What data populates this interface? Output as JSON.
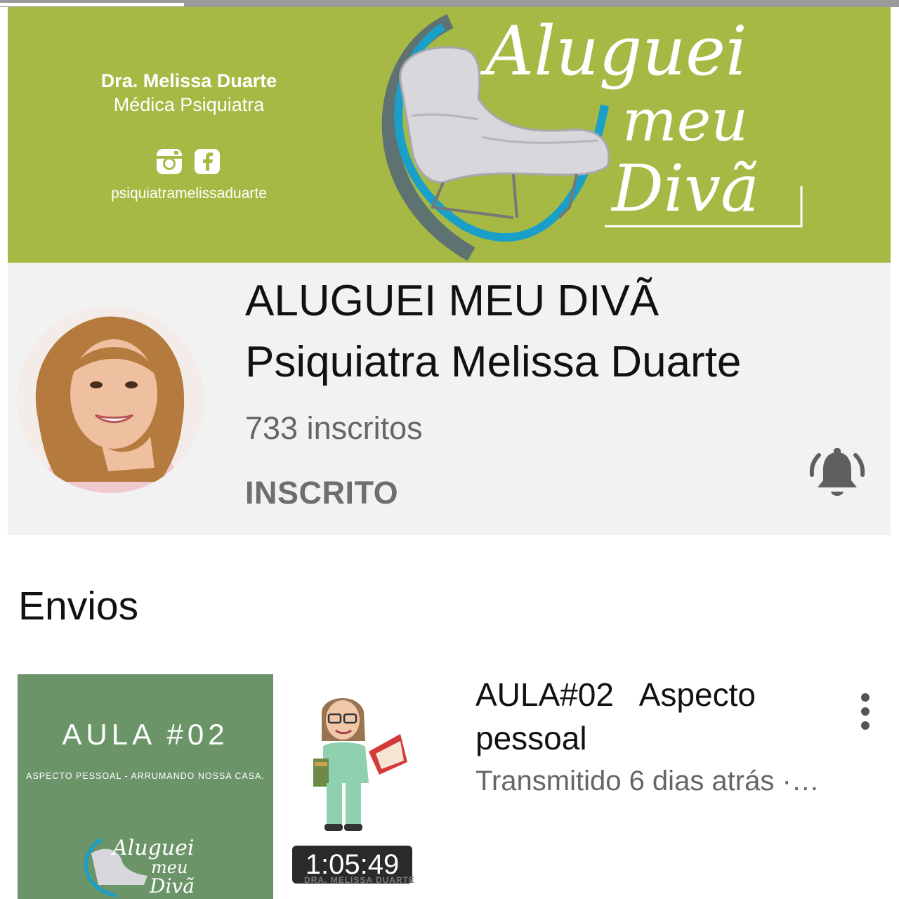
{
  "banner": {
    "doctor_name": "Dra. Melissa Duarte",
    "doctor_role": "Médica Psiquiatra",
    "social_handle": "psiquiatramelissaduarte",
    "logo_line1": "Aluguei",
    "logo_line2": "meu",
    "logo_line3": "Divã",
    "background_color": "#a6b944",
    "accent_color": "#1aa0c8"
  },
  "channel": {
    "title_line1": "ALUGUEI MEU DIVÃ",
    "title_line2": "Psiquiatra Melissa Duarte",
    "subscribers": "733 inscritos",
    "subscribe_label": "INSCRITO",
    "bell_icon": "bell-icon"
  },
  "section": {
    "title": "Envios"
  },
  "video": {
    "thumb_title": "AULA #02",
    "thumb_subtitle": "ASPECTO PESSOAL - ARRUMANDO NOSSA CASA.",
    "thumb_logo_line1": "Aluguei",
    "thumb_logo_line2": "meu",
    "thumb_logo_line3": "Divã",
    "duration": "1:05:49",
    "watermark": "DRA. MELISSA DUARTE",
    "title_line1": "AULA#02   Aspecto",
    "title_line2": "pessoal",
    "meta": "Transmitido 6 dias atrás ·…",
    "thumb_color": "#6b9468"
  }
}
